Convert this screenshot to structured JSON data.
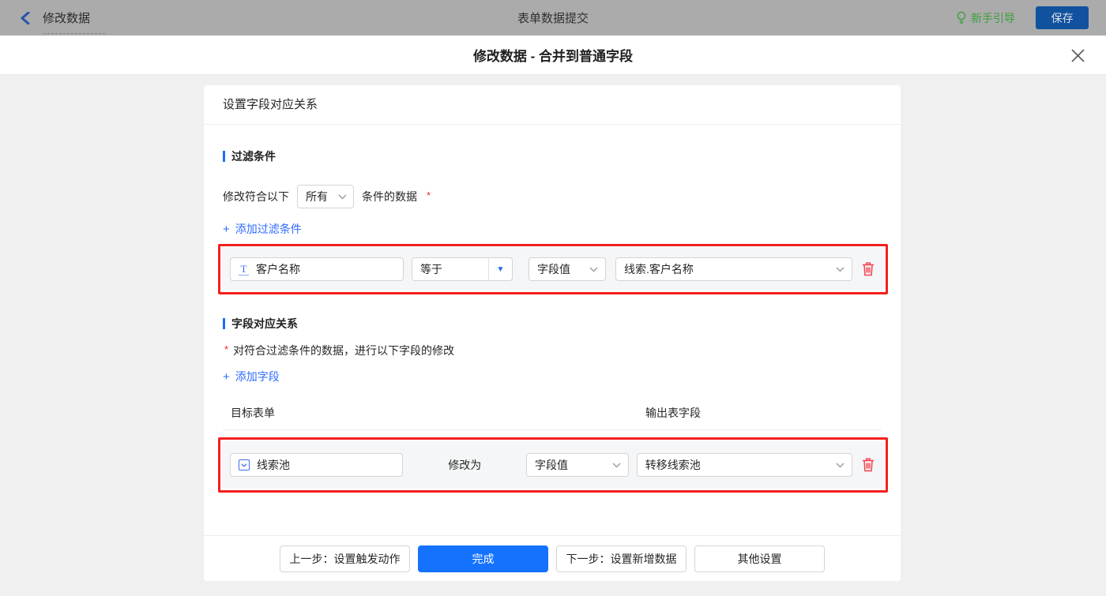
{
  "topbar": {
    "back_label": "修改数据",
    "center_title": "表单数据提交",
    "guide_label": "新手引导",
    "save_label": "保存"
  },
  "dialog": {
    "title": "修改数据 - 合并到普通字段"
  },
  "card": {
    "header": "设置字段对应关系",
    "filter_section": {
      "title": "过滤条件",
      "match_prefix": "修改符合以下",
      "match_select_value": "所有",
      "match_suffix": "条件的数据",
      "required_mark": "*",
      "add_label": "添加过滤条件",
      "condition_row": {
        "field": "客户名称",
        "operator": "等于",
        "value_type": "字段值",
        "value": "线索.客户名称"
      }
    },
    "mapping_section": {
      "title": "字段对应关系",
      "required_mark": "*",
      "note": "对符合过滤条件的数据，进行以下字段的修改",
      "add_label": "添加字段",
      "columns": {
        "target": "目标表单",
        "output": "输出表字段"
      },
      "row": {
        "field": "线索池",
        "middle_label": "修改为",
        "value_type": "字段值",
        "value": "转移线索池"
      }
    },
    "footer": {
      "prev_label": "上一步：设置触发动作",
      "done_label": "完成",
      "next_label": "下一步：设置新增数据",
      "other_label": "其他设置"
    }
  },
  "icons": {
    "plus": "+",
    "caret_down": "▼",
    "text_field_glyph": "T",
    "select_field_glyph": "∨"
  },
  "colors": {
    "accent_blue": "#1472ff",
    "link_blue": "#2f6bff",
    "section_bar_blue": "#1f6bff",
    "highlight_red": "#f51f1f",
    "danger_red": "#f5434f",
    "required_red": "#f5222d",
    "guide_green": "#3d9e3f",
    "topbar_dimmed": "#ababab",
    "body_bg": "#f0f0f0",
    "row_bg": "#f5f6f7",
    "border_gray": "#d4d4d4"
  }
}
